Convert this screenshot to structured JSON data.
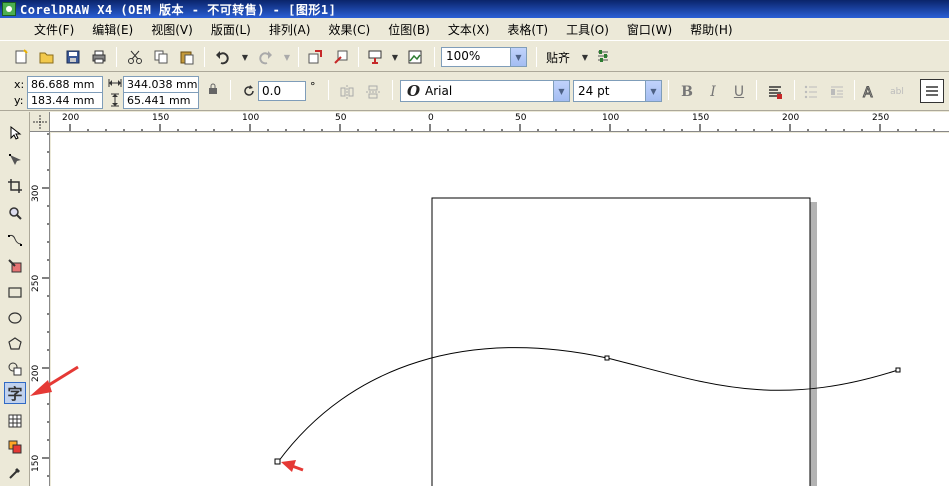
{
  "title": "CorelDRAW X4 (OEM 版本 - 不可转售) - [图形1]",
  "menu": [
    "文件(F)",
    "编辑(E)",
    "视图(V)",
    "版面(L)",
    "排列(A)",
    "效果(C)",
    "位图(B)",
    "文本(X)",
    "表格(T)",
    "工具(O)",
    "窗口(W)",
    "帮助(H)"
  ],
  "toolbar": {
    "zoom_value": "100%",
    "snap_label": "贴齐",
    "icons": [
      "new-icon",
      "open-icon",
      "save-icon",
      "print-icon",
      "cut-icon",
      "copy-icon",
      "paste-icon",
      "undo-icon",
      "redo-icon",
      "import-icon",
      "export-icon",
      "application-launcher-icon",
      "welcome-screen-icon",
      "options-icon"
    ]
  },
  "property_bar": {
    "x_label": "x:",
    "x_value": "86.688 mm",
    "y_label": "y:",
    "y_value": "183.44 mm",
    "width_value": "344.038 mm",
    "height_value": "65.441 mm",
    "angle_value": "0.0",
    "angle_unit": "°",
    "font_name": "Arial",
    "font_size": "24 pt",
    "style_buttons": [
      "bold-icon",
      "italic-icon",
      "underline-icon"
    ]
  },
  "ruler": {
    "top_labels": [
      "200",
      "150",
      "100",
      "50",
      "0",
      "50",
      "100",
      "150",
      "200",
      "250"
    ],
    "left_labels": [
      "300",
      "250",
      "200",
      "150"
    ]
  },
  "toolbox": {
    "tools": [
      "pick-tool-icon",
      "shape-tool-icon",
      "crop-tool-icon",
      "zoom-tool-icon",
      "freehand-tool-icon",
      "smart-fill-tool-icon",
      "rectangle-tool-icon",
      "ellipse-tool-icon",
      "polygon-tool-icon",
      "basic-shapes-tool-icon",
      "text-tool",
      "table-tool-icon",
      "interactive-fill-tool-icon",
      "eyedropper-tool-icon"
    ],
    "text_tool_glyph": "字"
  },
  "colors": {
    "title_bar": "#0a246a",
    "toolbar_bg": "#ece9d8",
    "annotation_arrow": "#e53935",
    "page_shadow": "#b3b3b3"
  }
}
